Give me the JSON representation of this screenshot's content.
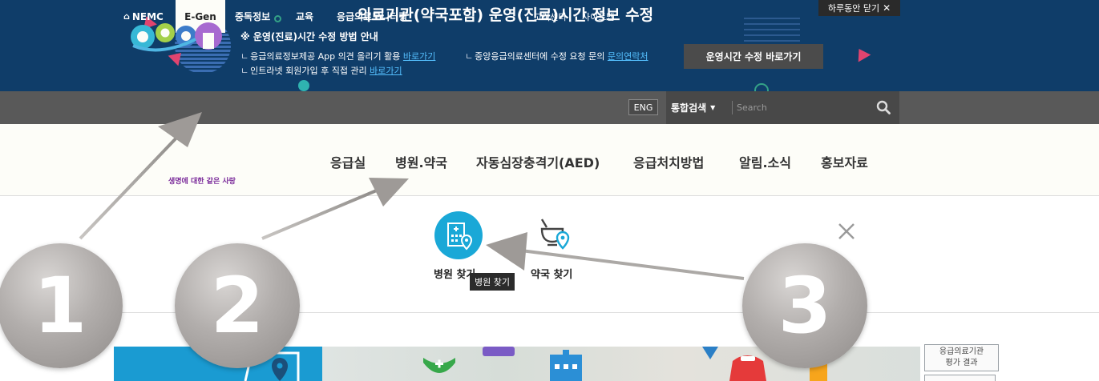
{
  "banner": {
    "title": "의료기관(약국포함) 운영(진료)시간 정보 수정",
    "subtitle": "※ 운영(진료)시간 수정 방법 안내",
    "line1_text": "응급의료정보제공 App 의견 올리기 활용 ",
    "line1_link": "바로가기",
    "line2_text": "중앙응급의료센터에 수정 요청 문의 ",
    "line2_link": "문의연락처",
    "line3_text": "인트라넷 회원가입 후 직접 관리 ",
    "line3_link": "바로가기",
    "bullet": "ㄴ",
    "hours_button": "운영시간 수정 바로가기",
    "close_today": "하루동안 닫기",
    "close_glyph": "✕"
  },
  "gnb": {
    "home_glyph": "⌂",
    "items": [
      "NEMC",
      "E-Gen",
      "중독정보",
      "교육",
      "응급의료모니터링"
    ],
    "active_index": 1,
    "util": [
      "고객센터",
      "사이트맵",
      "ENG"
    ],
    "search_category": "통합검색",
    "search_placeholder": "Search"
  },
  "header": {
    "logo_tagline": "생명에 대한 같은 사랑",
    "menu": [
      "응급실",
      "병원.약국",
      "자동심장충격기(AED)",
      "응급처치방법",
      "알림.소식",
      "홍보자료"
    ]
  },
  "dropdown": {
    "hospital_label": "병원 찾기",
    "pharmacy_label": "약국 찾기",
    "tooltip": "병원 찾기"
  },
  "content": {
    "eval_label_line1": "응급의료기관",
    "eval_label_line2": "평가 결과"
  },
  "tutorial": {
    "steps": [
      "1",
      "2",
      "3"
    ]
  },
  "colors": {
    "banner_bg": "#0f3d69",
    "nav_bg": "#595959",
    "accent_blue": "#1aa8d7",
    "link": "#55c0ff"
  }
}
